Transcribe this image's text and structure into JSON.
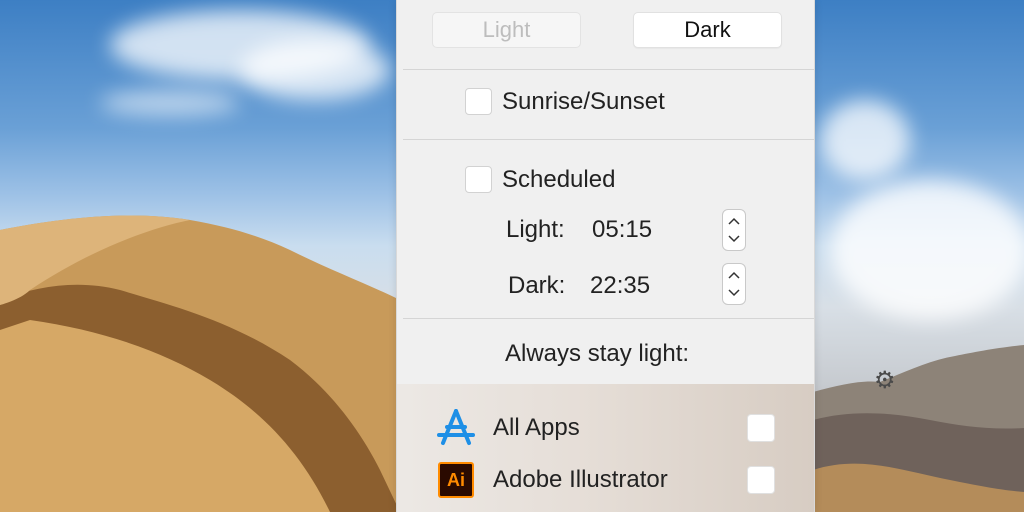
{
  "appearance": {
    "light_label": "Light",
    "dark_label": "Dark"
  },
  "sunrise_sunset": {
    "label": "Sunrise/Sunset",
    "checked": false
  },
  "scheduled": {
    "label": "Scheduled",
    "checked": false,
    "light_label": "Light:",
    "light_time": "05:15",
    "dark_label": "Dark:",
    "dark_time": "22:35"
  },
  "always_light": {
    "heading": "Always stay light:",
    "apps": [
      {
        "name": "All Apps",
        "icon": "app-store-icon",
        "checked": false
      },
      {
        "name": "Adobe Illustrator",
        "icon": "adobe-illustrator-icon",
        "icon_text": "Ai",
        "checked": false
      }
    ]
  },
  "colors": {
    "accent_orange": "#ff8b00",
    "app_store_blue": "#1e8fe6"
  }
}
